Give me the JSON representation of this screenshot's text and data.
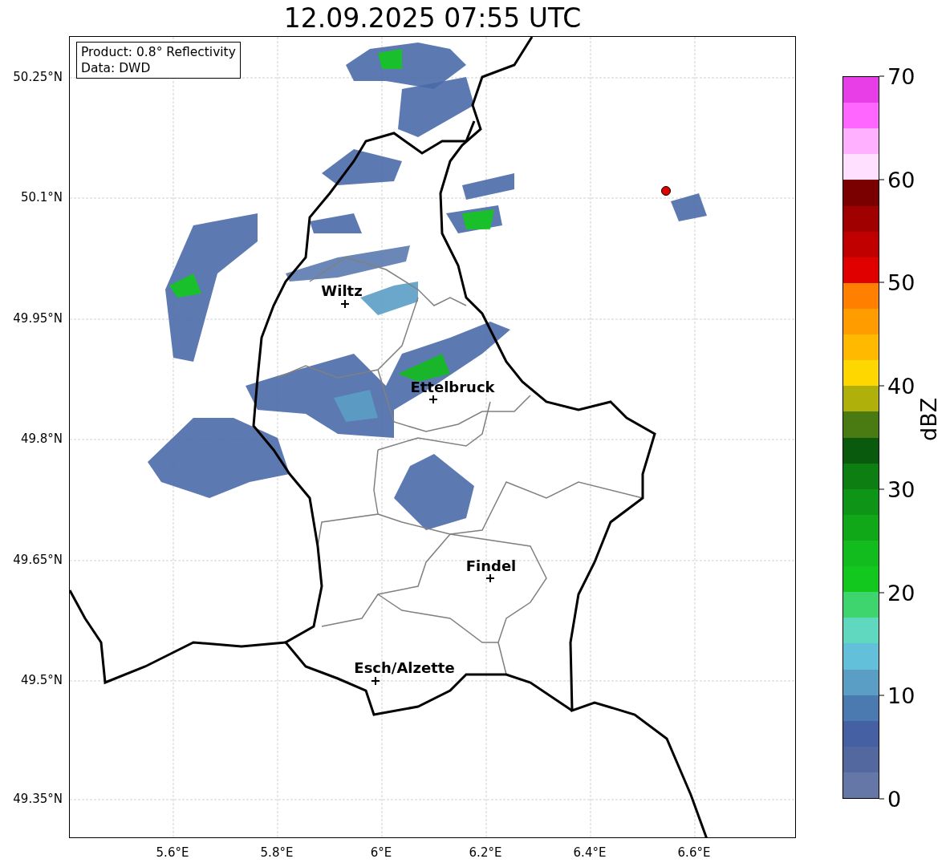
{
  "title": "12.09.2025 07:55 UTC",
  "legend": [
    "Product: 0.8° Reflectivity",
    "Data: DWD"
  ],
  "map": {
    "x_ticks": [
      "5.6°E",
      "5.8°E",
      "6°E",
      "6.2°E",
      "6.4°E",
      "6.6°E"
    ],
    "y_ticks": [
      "50.25°N",
      "50.1°N",
      "49.95°N",
      "49.8°N",
      "49.65°N",
      "49.5°N",
      "49.35°N"
    ],
    "cities": [
      {
        "name": "Wiltz"
      },
      {
        "name": "Ettelbruck"
      },
      {
        "name": "Findel"
      },
      {
        "name": "Esch/Alzette"
      }
    ]
  },
  "colorbar": {
    "label": "dBZ",
    "ticks": [
      "70",
      "60",
      "50",
      "40",
      "30",
      "20",
      "10",
      "0"
    ],
    "bins": [
      {
        "color": "#e83ee8"
      },
      {
        "color": "#ff66ff"
      },
      {
        "color": "#ffb0ff"
      },
      {
        "color": "#ffe0ff"
      },
      {
        "color": "#7a0000"
      },
      {
        "color": "#a00000"
      },
      {
        "color": "#c00000"
      },
      {
        "color": "#e00000"
      },
      {
        "color": "#ff8000"
      },
      {
        "color": "#ff9c00"
      },
      {
        "color": "#ffba00"
      },
      {
        "color": "#ffd700"
      },
      {
        "color": "#b0b00a"
      },
      {
        "color": "#4a7a12"
      },
      {
        "color": "#0a5a0e"
      },
      {
        "color": "#0c7e12"
      },
      {
        "color": "#0e9416"
      },
      {
        "color": "#10a818"
      },
      {
        "color": "#12bc1e"
      },
      {
        "color": "#12c81e"
      },
      {
        "color": "#3ed46e"
      },
      {
        "color": "#60d8c0"
      },
      {
        "color": "#63c0db"
      },
      {
        "color": "#5a9dc5"
      },
      {
        "color": "#4a7ab0"
      },
      {
        "color": "#4561a3"
      },
      {
        "color": "#5468a0"
      },
      {
        "color": "#6577a6"
      }
    ]
  }
}
